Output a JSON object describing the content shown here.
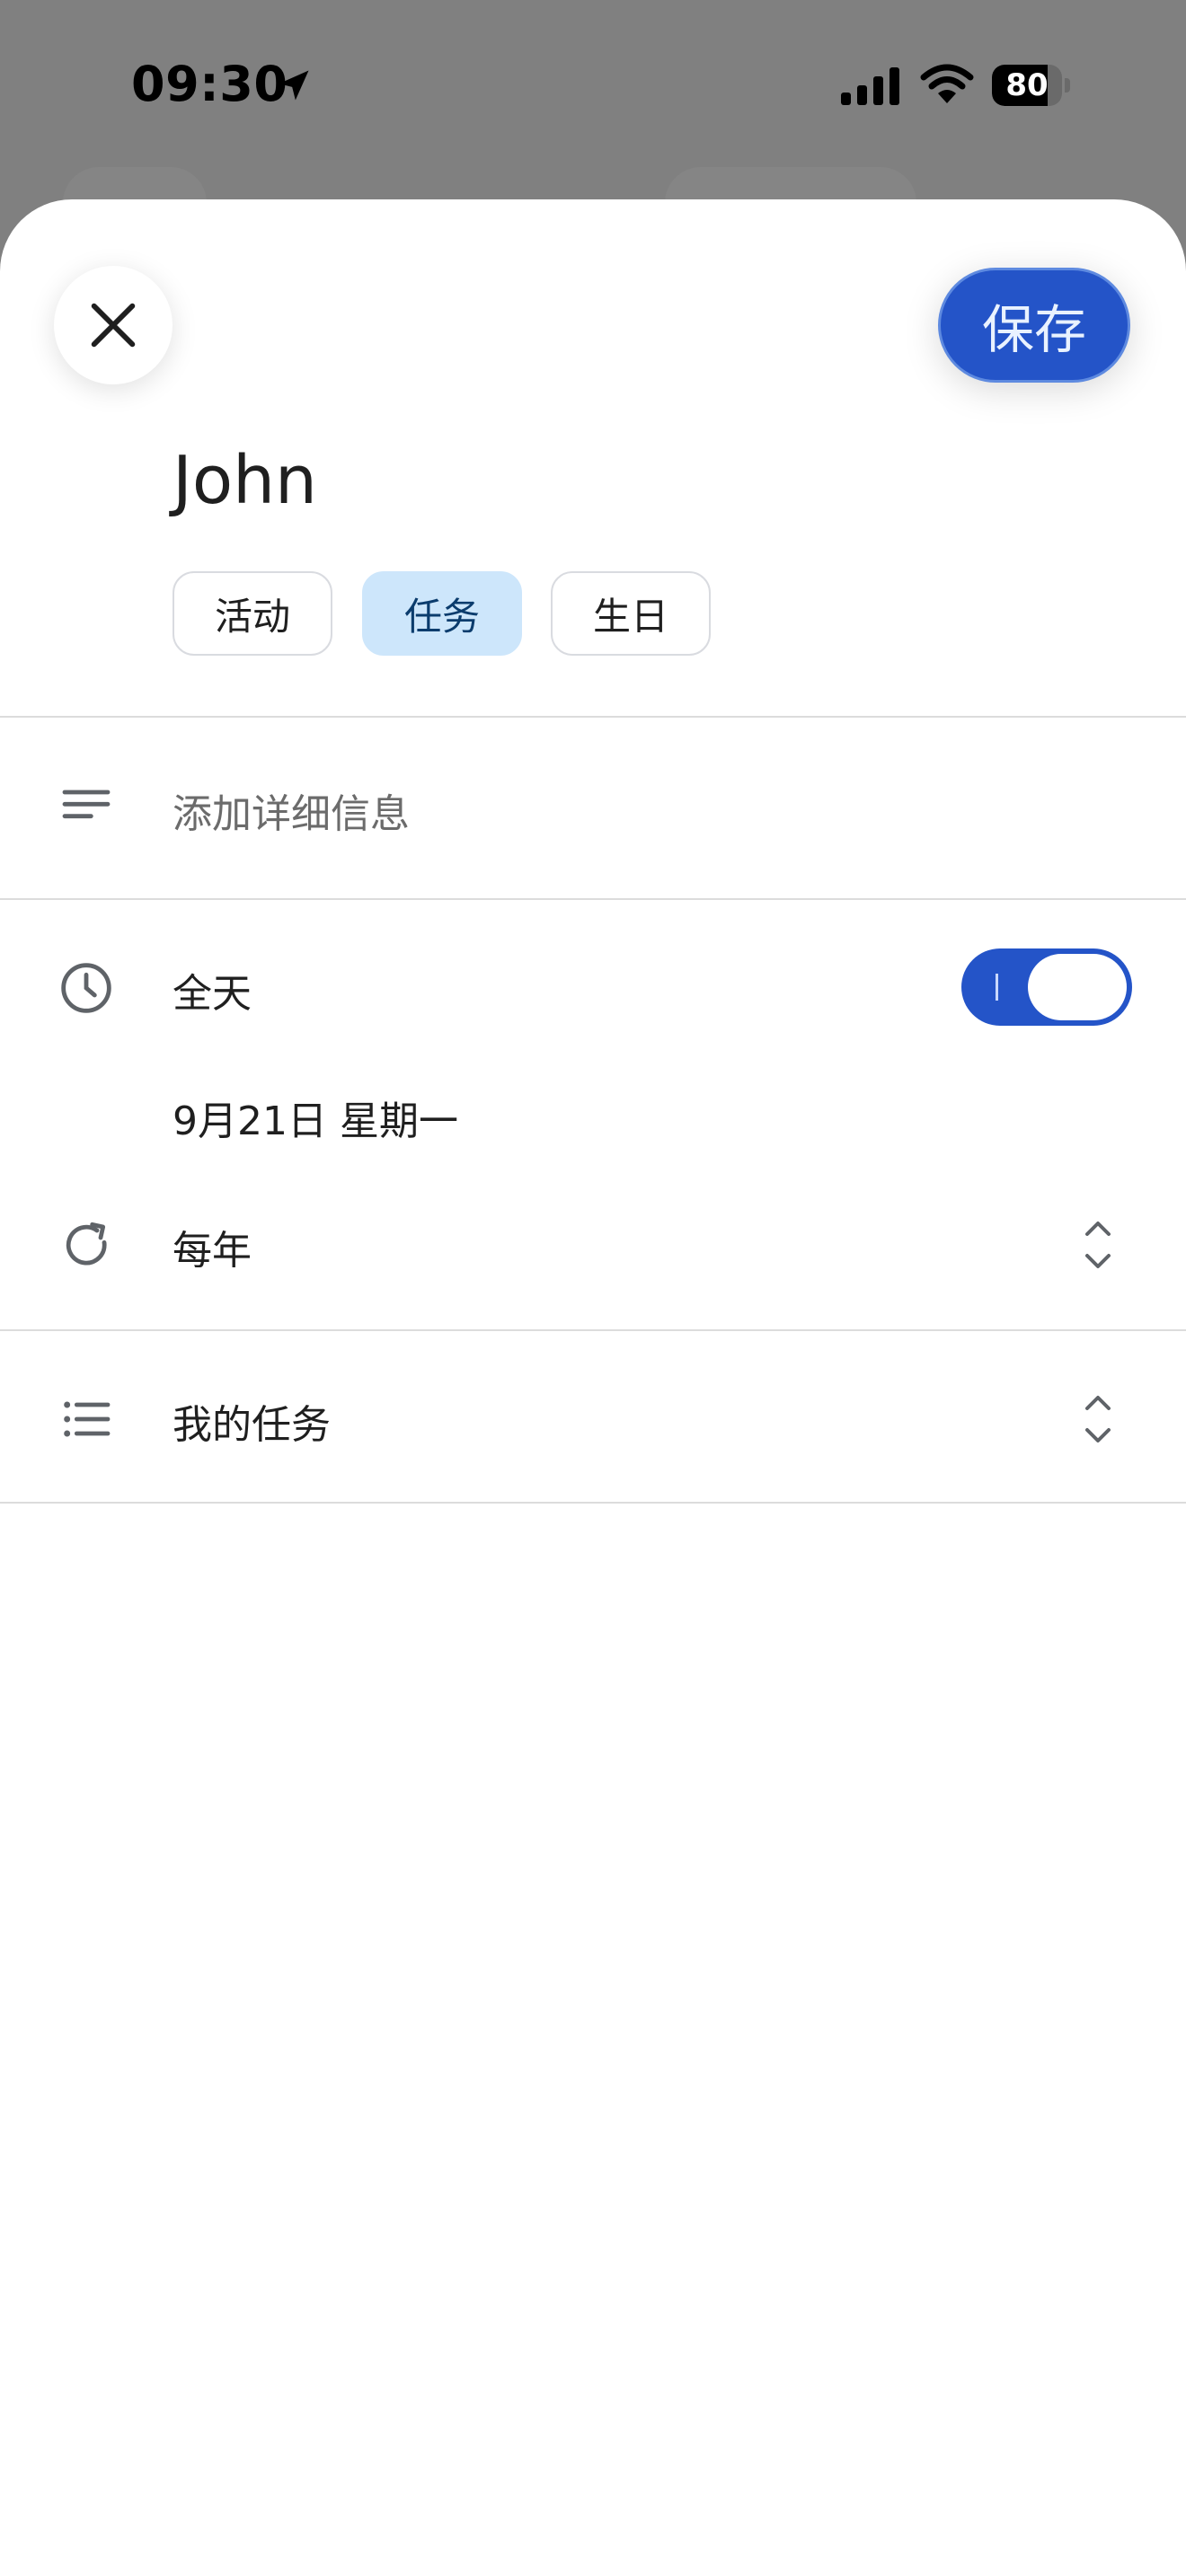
{
  "status_bar": {
    "time": "09:30",
    "battery": "80",
    "battery_level": 0.8
  },
  "header": {
    "close_icon": "close-icon",
    "save_label": "保存"
  },
  "title": "John",
  "type_tabs": [
    {
      "label": "活动",
      "selected": false
    },
    {
      "label": "任务",
      "selected": true
    },
    {
      "label": "生日",
      "selected": false
    }
  ],
  "details": {
    "placeholder": "添加详细信息",
    "icon": "notes-icon"
  },
  "all_day": {
    "label": "全天",
    "enabled": true,
    "icon": "clock-icon"
  },
  "date": {
    "label": "9月21日 星期一"
  },
  "repeat": {
    "label": "每年",
    "icon": "repeat-icon"
  },
  "task_list": {
    "label": "我的任务",
    "icon": "list-icon"
  },
  "colors": {
    "accent": "#2454c8",
    "chip_selected": "#cde6fb"
  }
}
